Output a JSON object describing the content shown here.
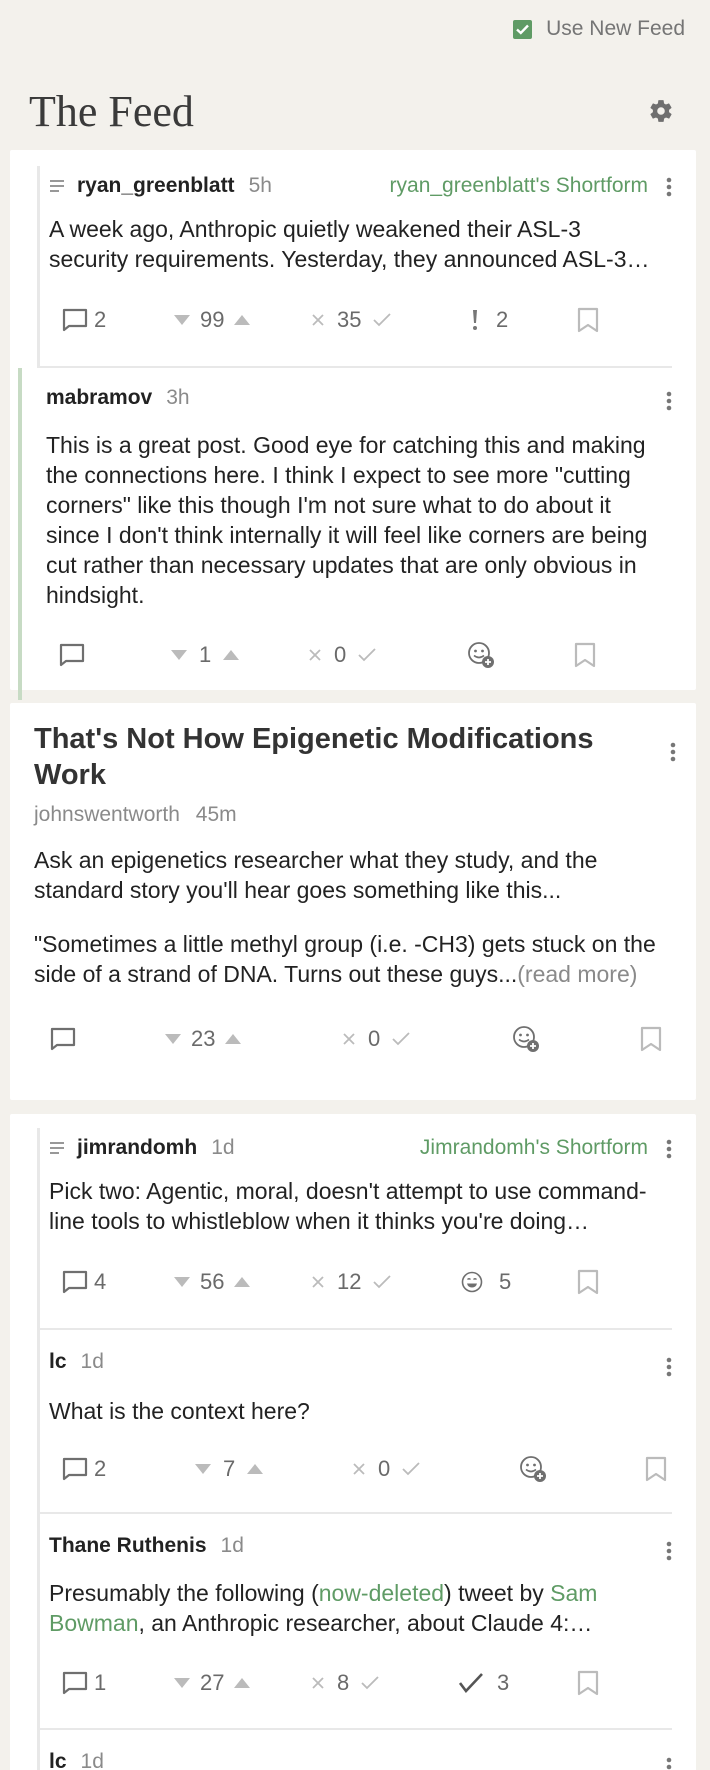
{
  "topbar": {
    "toggle_label": "Use New Feed",
    "checked": true
  },
  "feed": {
    "title": "The Feed"
  },
  "cards": {
    "c1": {
      "parent": {
        "author": "ryan_greenblatt",
        "age": "5h",
        "shortform": "ryan_greenblatt's Shortform",
        "line1": "A week ago, Anthropic quietly weakened their ASL-3",
        "line2": "security requirements. Yesterday, they announced ASL-3…",
        "comments": "2",
        "karma": "99",
        "agree": "35",
        "react_count": "2"
      },
      "reply": {
        "author": "mabramov",
        "age": "3h",
        "text": "This is a great post. Good eye for catching this and making the connections here. I think I expect to see more \"cutting corners\" like this though I'm not sure what to do about it since I don't think internally it will feel like corners are being cut rather than necessary updates that are only obvious in hindsight.",
        "karma": "1",
        "agree": "0"
      }
    },
    "c2": {
      "title": "That's Not How Epigenetic Modifications Work",
      "author": "johnswentworth",
      "age": "45m",
      "p1": "Ask an epigenetics researcher what they study, and the standard story you'll hear goes something like this...",
      "p2": "\"Sometimes a little methyl group (i.e. -CH3) gets stuck on the side of a strand of DNA. Turns out these guys...",
      "read_more": "(read more)",
      "karma": "23",
      "agree": "0"
    },
    "c3": {
      "parent": {
        "author": "jimrandomh",
        "age": "1d",
        "shortform": "Jimrandomh's Shortform",
        "line1": "Pick two: Agentic, moral, doesn't attempt to use command-",
        "line2": "line tools to whistleblow when it thinks you're doing…",
        "comments": "4",
        "karma": "56",
        "agree": "12",
        "react_count": "5"
      },
      "reply1": {
        "author": "lc",
        "age": "1d",
        "text": "What is the context here?",
        "comments": "2",
        "karma": "7",
        "agree": "0"
      },
      "reply2": {
        "author": "Thane Ruthenis",
        "age": "1d",
        "pre": "Presumably the following (",
        "link1": "now-deleted",
        "mid": ") tweet by ",
        "link2_a": "Sam",
        "link2_b": "Bowman",
        "post": ", an Anthropic researcher, about Claude 4:…",
        "comments": "1",
        "karma": "27",
        "agree": "8",
        "react_count": "3"
      },
      "reply3": {
        "author": "lc",
        "age": "1d"
      }
    }
  }
}
